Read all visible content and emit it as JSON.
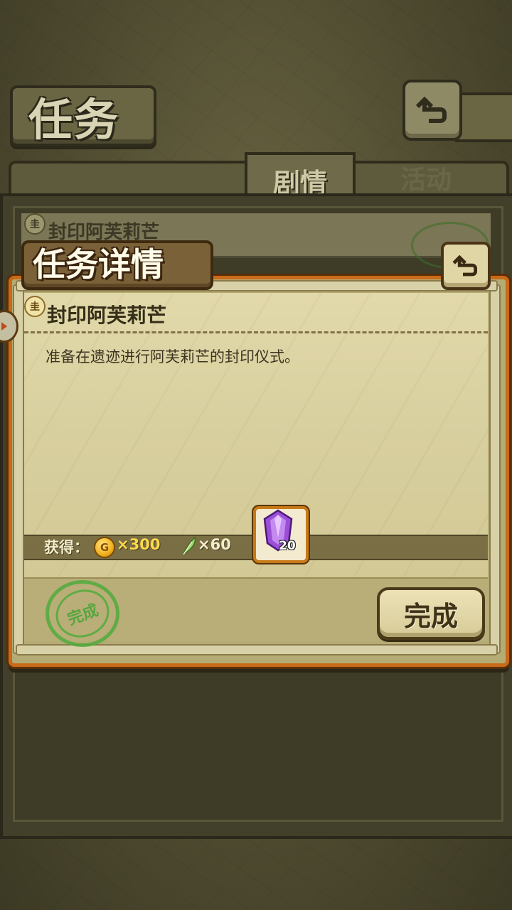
{
  "background_screen": {
    "title": "任务",
    "tabs": [
      {
        "label": "剧情",
        "active": true
      },
      {
        "label": "活动",
        "active": false
      }
    ],
    "task_rows": [
      {
        "title": "封印阿芙莉芒",
        "rank_icon": "圭"
      }
    ]
  },
  "dialog": {
    "header": "任务详情",
    "close_icon": "return-arrow-icon",
    "task": {
      "rank_icon": "圭",
      "title": "封印阿芙莉芒",
      "description": "准备在遗迹进行阿芙莉芒的封印仪式。"
    },
    "rewards": {
      "label": "获得：",
      "coin_symbol": "G",
      "coin_amount": "×300",
      "feather_amount": "×60",
      "gem_count": "20"
    },
    "stamp_text": "完成",
    "complete_button": "完成"
  },
  "colors": {
    "dialog_border": "#c86a18",
    "parchment": "#ddd4a4",
    "coin_text": "#ffd94a",
    "stamp_green": "#50aa3c",
    "gem_purple": "#9b4fd6"
  }
}
